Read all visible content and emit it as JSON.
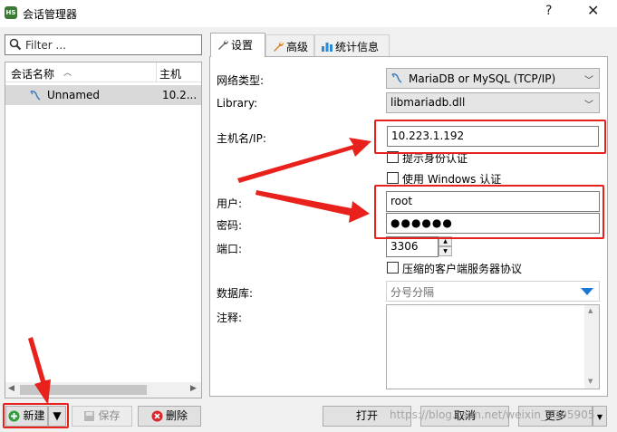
{
  "window": {
    "title": "会话管理器",
    "app_icon_text": "HS",
    "help_symbol": "?",
    "close_symbol": "✕"
  },
  "left_panel": {
    "filter_placeholder": "Filter ...",
    "columns": {
      "name": "会话名称",
      "host": "主机"
    },
    "sessions": [
      {
        "name": "Unnamed",
        "host": "10.2..."
      }
    ],
    "buttons": {
      "new": "新建",
      "save": "保存",
      "delete": "删除"
    }
  },
  "tabs": [
    {
      "label": "设置",
      "icon": "wrench-icon",
      "active": true
    },
    {
      "label": "高级",
      "icon": "wrench-icon",
      "active": false
    },
    {
      "label": "统计信息",
      "icon": "bar-chart-icon",
      "active": false
    }
  ],
  "settings": {
    "network_type_label": "网络类型:",
    "network_type_value": "MariaDB or MySQL (TCP/IP)",
    "library_label": "Library:",
    "library_value": "libmariadb.dll",
    "host_label": "主机名/IP:",
    "host_value": "10.223.1.192",
    "prompt_auth_label": "提示身份认证",
    "windows_auth_label": "使用 Windows 认证",
    "user_label": "用户:",
    "user_value": "root",
    "password_label": "密码:",
    "password_value": "●●●●●●",
    "port_label": "端口:",
    "port_value": "3306",
    "compressed_label": "压缩的客户端服务器协议",
    "database_label": "数据库:",
    "database_placeholder": "分号分隔",
    "comment_label": "注释:"
  },
  "footer_buttons": {
    "open": "打开",
    "cancel": "取消",
    "more": "更多"
  },
  "watermark": "https://blog.csdn.net/weixin_4395905",
  "colors": {
    "annotation_red": "#e8211d",
    "dropdown_arrow_blue": "#1a78d4",
    "window_bg": "#f0f0f0"
  }
}
